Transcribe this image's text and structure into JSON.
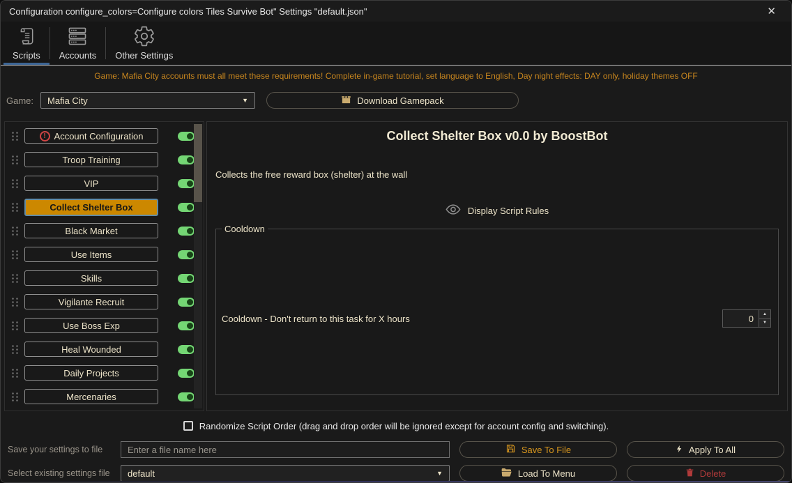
{
  "window": {
    "title": "Configuration configure_colors=Configure colors Tiles Survive Bot\" Settings \"default.json\""
  },
  "icons": {
    "close": "✕",
    "dropdown_arrow": "▼",
    "spin_up": "▲",
    "spin_down": "▼",
    "warning_glyph": "!"
  },
  "tabs": [
    {
      "label": "Scripts",
      "icon": "scroll-icon",
      "active": true
    },
    {
      "label": "Accounts",
      "icon": "servers-icon",
      "active": false
    },
    {
      "label": "Other Settings",
      "icon": "gear-icon",
      "active": false
    }
  ],
  "warning": "Game: Mafia City accounts must all meet these requirements! Complete in-game tutorial, set language to English, Day night effects: DAY only, holiday themes OFF",
  "game_row": {
    "label": "Game:",
    "selected_game": "Mafia City",
    "download_button": "Download Gamepack"
  },
  "scripts": {
    "items": [
      {
        "label": "Account Configuration",
        "warning": true,
        "enabled": true,
        "selected": false
      },
      {
        "label": "Troop Training",
        "warning": false,
        "enabled": true,
        "selected": false
      },
      {
        "label": "VIP",
        "warning": false,
        "enabled": true,
        "selected": false
      },
      {
        "label": "Collect Shelter Box",
        "warning": false,
        "enabled": true,
        "selected": true
      },
      {
        "label": "Black Market",
        "warning": false,
        "enabled": true,
        "selected": false
      },
      {
        "label": "Use Items",
        "warning": false,
        "enabled": true,
        "selected": false
      },
      {
        "label": "Skills",
        "warning": false,
        "enabled": true,
        "selected": false
      },
      {
        "label": "Vigilante Recruit",
        "warning": false,
        "enabled": true,
        "selected": false
      },
      {
        "label": "Use Boss Exp",
        "warning": false,
        "enabled": true,
        "selected": false
      },
      {
        "label": "Heal Wounded",
        "warning": false,
        "enabled": true,
        "selected": false
      },
      {
        "label": "Daily Projects",
        "warning": false,
        "enabled": true,
        "selected": false
      },
      {
        "label": "Mercenaries",
        "warning": false,
        "enabled": true,
        "selected": false
      }
    ]
  },
  "panel": {
    "title": "Collect Shelter Box v0.0 by BoostBot",
    "description": "Collects the free reward box (shelter) at the wall",
    "rules_link": "Display Script Rules",
    "cooldown_group": {
      "title": "Cooldown",
      "row_label": "Cooldown - Don't return to this task for X hours",
      "value": "0"
    }
  },
  "randomize": {
    "label": "Randomize Script Order (drag and drop order will be ignored except for account config and switching).",
    "checked": false
  },
  "footer": {
    "save_label": "Save your settings to file",
    "file_input_placeholder": "Enter a file name here",
    "select_label": "Select existing settings file",
    "selected_file": "default",
    "buttons": {
      "save": "Save To File",
      "apply": "Apply To All",
      "load": "Load To Menu",
      "delete": "Delete"
    }
  },
  "colors": {
    "accent_orange": "#d7961e",
    "warning_orange": "#c8861e",
    "selected_item_orange": "#cc8800",
    "selected_item_border_blue": "#628ba5",
    "toggle_green": "#74d674",
    "tab_underline_blue": "#3c6595",
    "delete_red": "#b03a3a",
    "cream_text": "#ece3c8"
  }
}
